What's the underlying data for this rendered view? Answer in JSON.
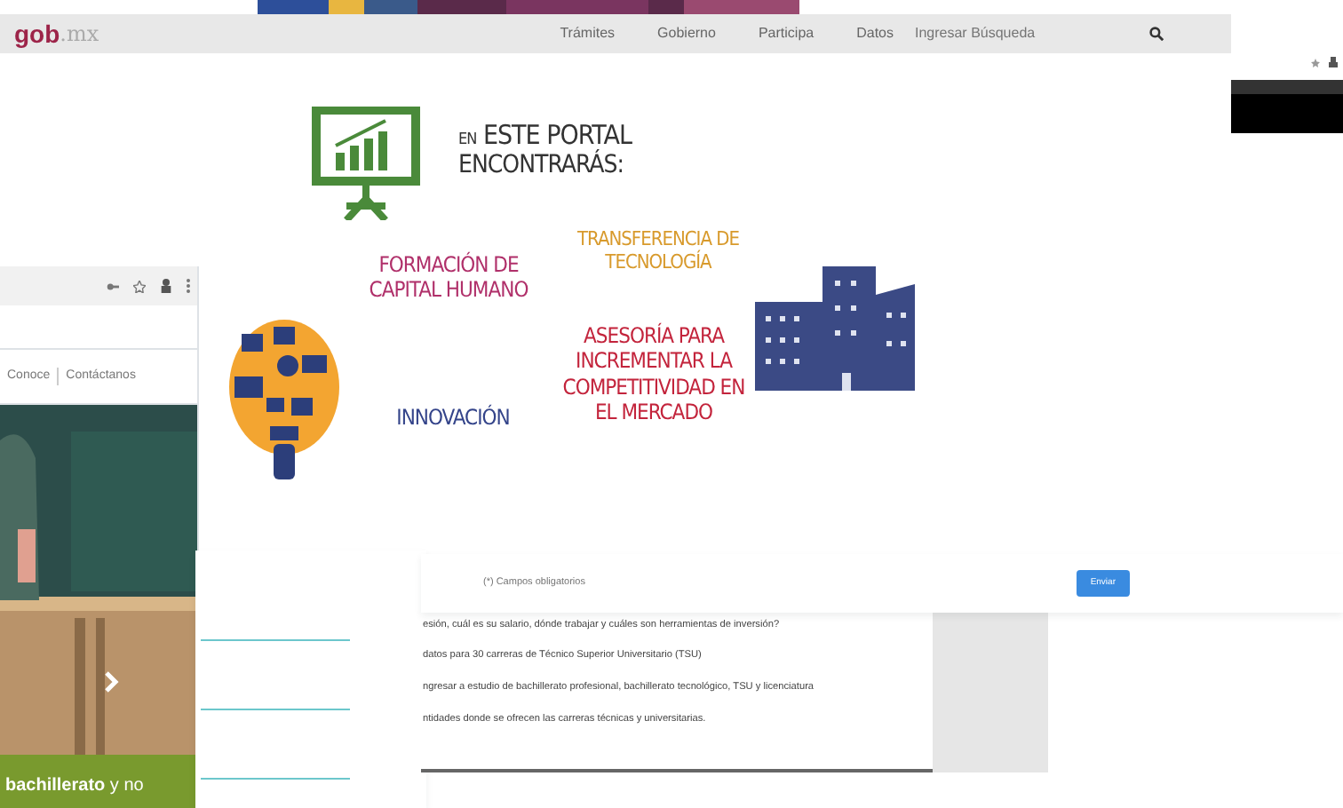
{
  "main_window": {
    "logo": "gob",
    "logo_suffix": ".mx",
    "nav": [
      "Trámites",
      "Gobierno",
      "Participa",
      "Datos"
    ],
    "search_placeholder": "Ingresar Búsqueda",
    "poster": {
      "intro_small": "EN",
      "intro": "ESTE PORTAL",
      "intro_2": "ENCONTRARÁS:",
      "items": [
        {
          "kind": "formacion",
          "text": "FORMACIÓN DE CAPITAL HUMANO",
          "color": "#b0306a"
        },
        {
          "kind": "transferencia",
          "text": "TRANSFERENCIA DE TECNOLOGÍA",
          "color": "#d89a2c"
        },
        {
          "kind": "innovacion",
          "text": "INNOVACIÓN",
          "color": "#34448a"
        },
        {
          "kind": "asesoria",
          "text": "ASESORÍA PARA INCREMENTAR LA COMPETITIVIDAD EN EL MERCADO",
          "color": "#c3243c"
        }
      ]
    }
  },
  "left_window": {
    "nav": [
      "Conoce",
      "Contáctanos"
    ],
    "banner": "**bachillerato** y no"
  },
  "form_window": {
    "placeholder": "(*) Campos obligatorios",
    "button": "Enviar",
    "lines": [
      "esión, cuál es su salario, dónde trabajar y cuáles son herramientas de inversión?",
      "datos para 30 carreras de Técnico Superior Universitario (TSU)",
      "ngresar a estudio de bachillerato profesional, bachillerato tecnológico, TSU y licenciatura",
      "ntidades donde se ofrecen las carreras técnicas y universitarias."
    ]
  }
}
